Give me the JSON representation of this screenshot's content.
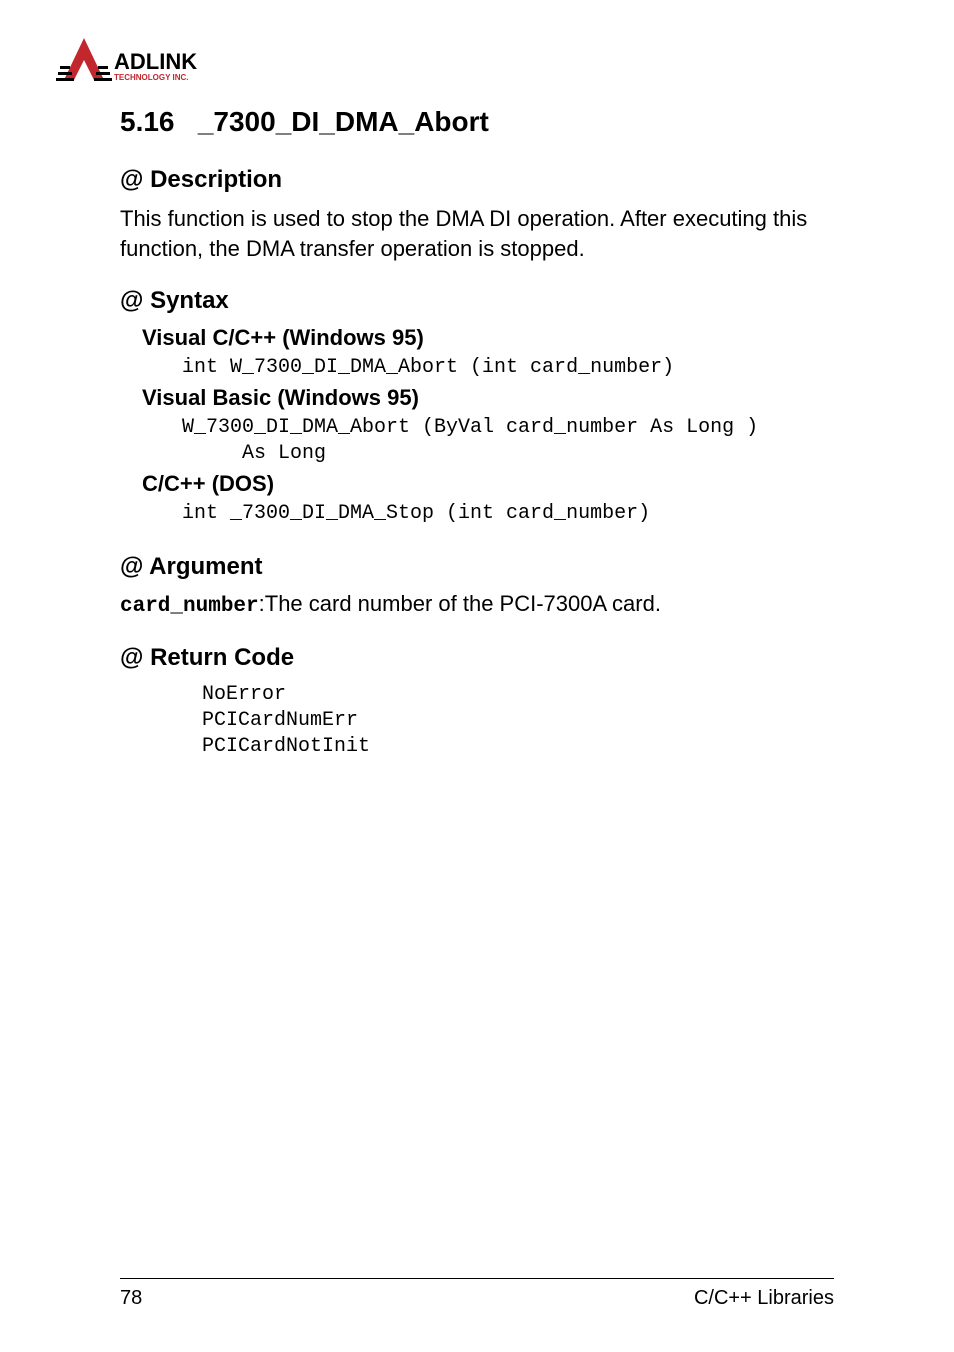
{
  "logo": {
    "name": "ADLINK",
    "tagline": "TECHNOLOGY INC."
  },
  "section": {
    "number": "5.16",
    "title": "_7300_DI_DMA_Abort"
  },
  "description": {
    "heading": "@ Description",
    "text": "This function is used to stop the DMA DI operation. After executing this function, the DMA transfer operation is stopped."
  },
  "syntax": {
    "heading": "@ Syntax",
    "langs": [
      {
        "label": "Visual C/C++ (Windows 95)",
        "code": [
          "int W_7300_DI_DMA_Abort (int card_number)"
        ]
      },
      {
        "label": "Visual Basic (Windows 95)",
        "code": [
          "W_7300_DI_DMA_Abort (ByVal card_number As Long )",
          "     As Long"
        ]
      },
      {
        "label": "C/C++ (DOS)",
        "code": [
          "int _7300_DI_DMA_Stop (int card_number)"
        ]
      }
    ]
  },
  "argument": {
    "heading": "@ Argument",
    "param": "card_number",
    "separator": ":",
    "desc": "The card number of the PCI-7300A card."
  },
  "returnCode": {
    "heading": "@ Return Code",
    "codes": [
      "NoError",
      "PCICardNumErr",
      "PCICardNotInit"
    ]
  },
  "footer": {
    "pageNumber": "78",
    "section": "C/C++ Libraries"
  }
}
